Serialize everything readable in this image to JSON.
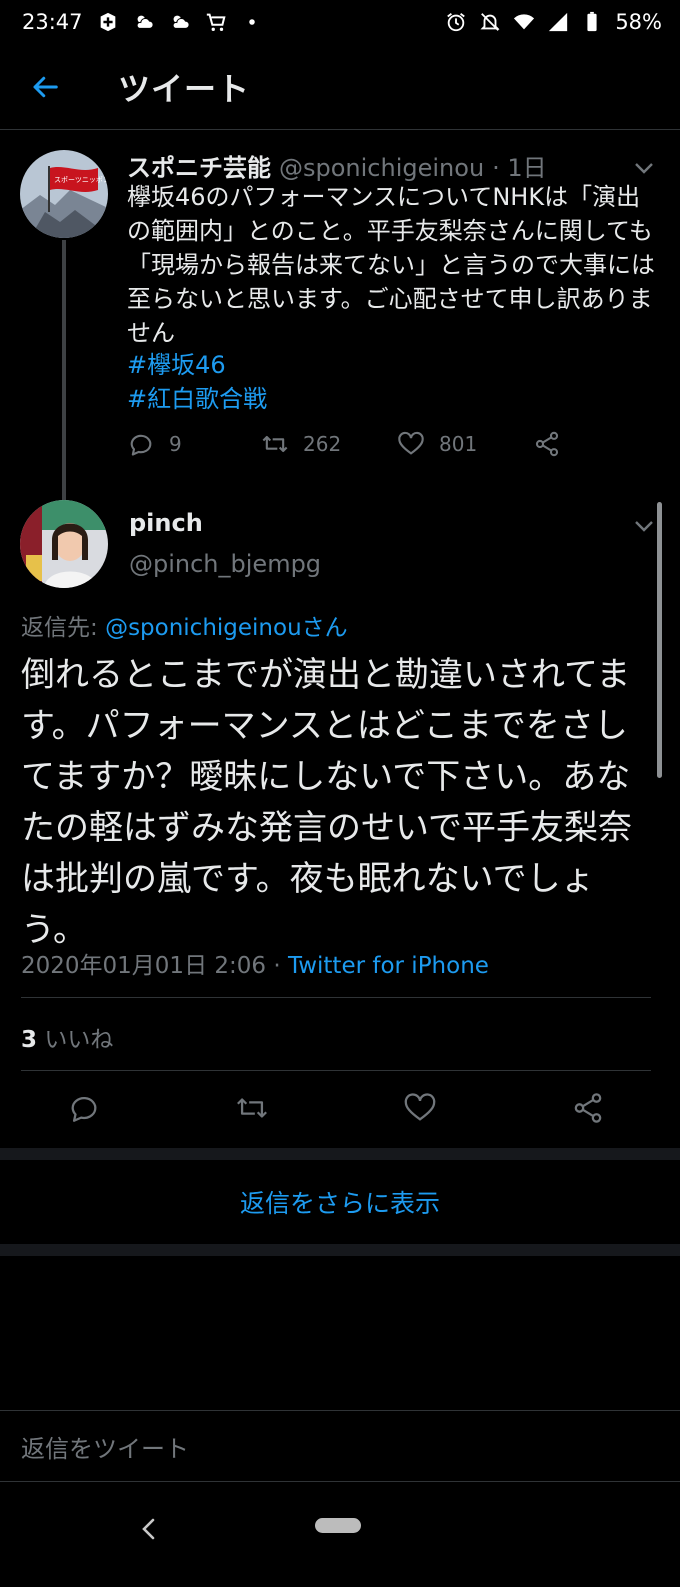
{
  "status_bar": {
    "time": "23:47",
    "battery": "58%",
    "left_icons": [
      "app-notification-icon",
      "cloud-sun-icon",
      "cloud-sun-icon",
      "shopping-cart-icon",
      "dot-icon"
    ],
    "right_icons": [
      "alarm-icon",
      "bell-off-icon",
      "wifi-icon",
      "signal-icon",
      "battery-icon"
    ]
  },
  "header": {
    "title": "ツイート",
    "back_icon": "arrow-left-icon"
  },
  "parent_tweet": {
    "display_name": "スポニチ芸能",
    "handle": "@sponichigeinou",
    "time": "· 1日",
    "text": "欅坂46のパフォーマンスについてNHKは「演出の範囲内」とのこと。平手友梨奈さんに関しても「現場から報告は来てない」と言うので大事には至らないと思います。ご心配させて申し訳ありません",
    "hashtags": [
      "#欅坂46",
      "#紅白歌合戦"
    ],
    "replies": "9",
    "retweets": "262",
    "likes": "801",
    "avatar_text": "スポーツニッポン"
  },
  "main_tweet": {
    "display_name": "pinch",
    "handle": "@pinch_bjempg",
    "reply_label": "返信先:",
    "reply_mention": "@sponichigeinouさん",
    "text": "倒れるとこまでが演出と勘違いされてます。パフォーマンスとはどこまでをさしてますか？曖昧にしないで下さい。あなたの軽はずみな発言のせいで平手友梨奈は批判の嵐です。夜も眠れないでしょう。",
    "timestamp": "2020年01月01日 2:06",
    "separator": " · ",
    "client": "Twitter for iPhone",
    "likes_count": "3",
    "likes_label": "いいね"
  },
  "more_replies": "返信をさらに表示",
  "reply_placeholder": "返信をツイート",
  "colors": {
    "accent": "#1d9bf0",
    "background": "#000000",
    "muted": "#71767b",
    "text": "#e7e9ea"
  }
}
